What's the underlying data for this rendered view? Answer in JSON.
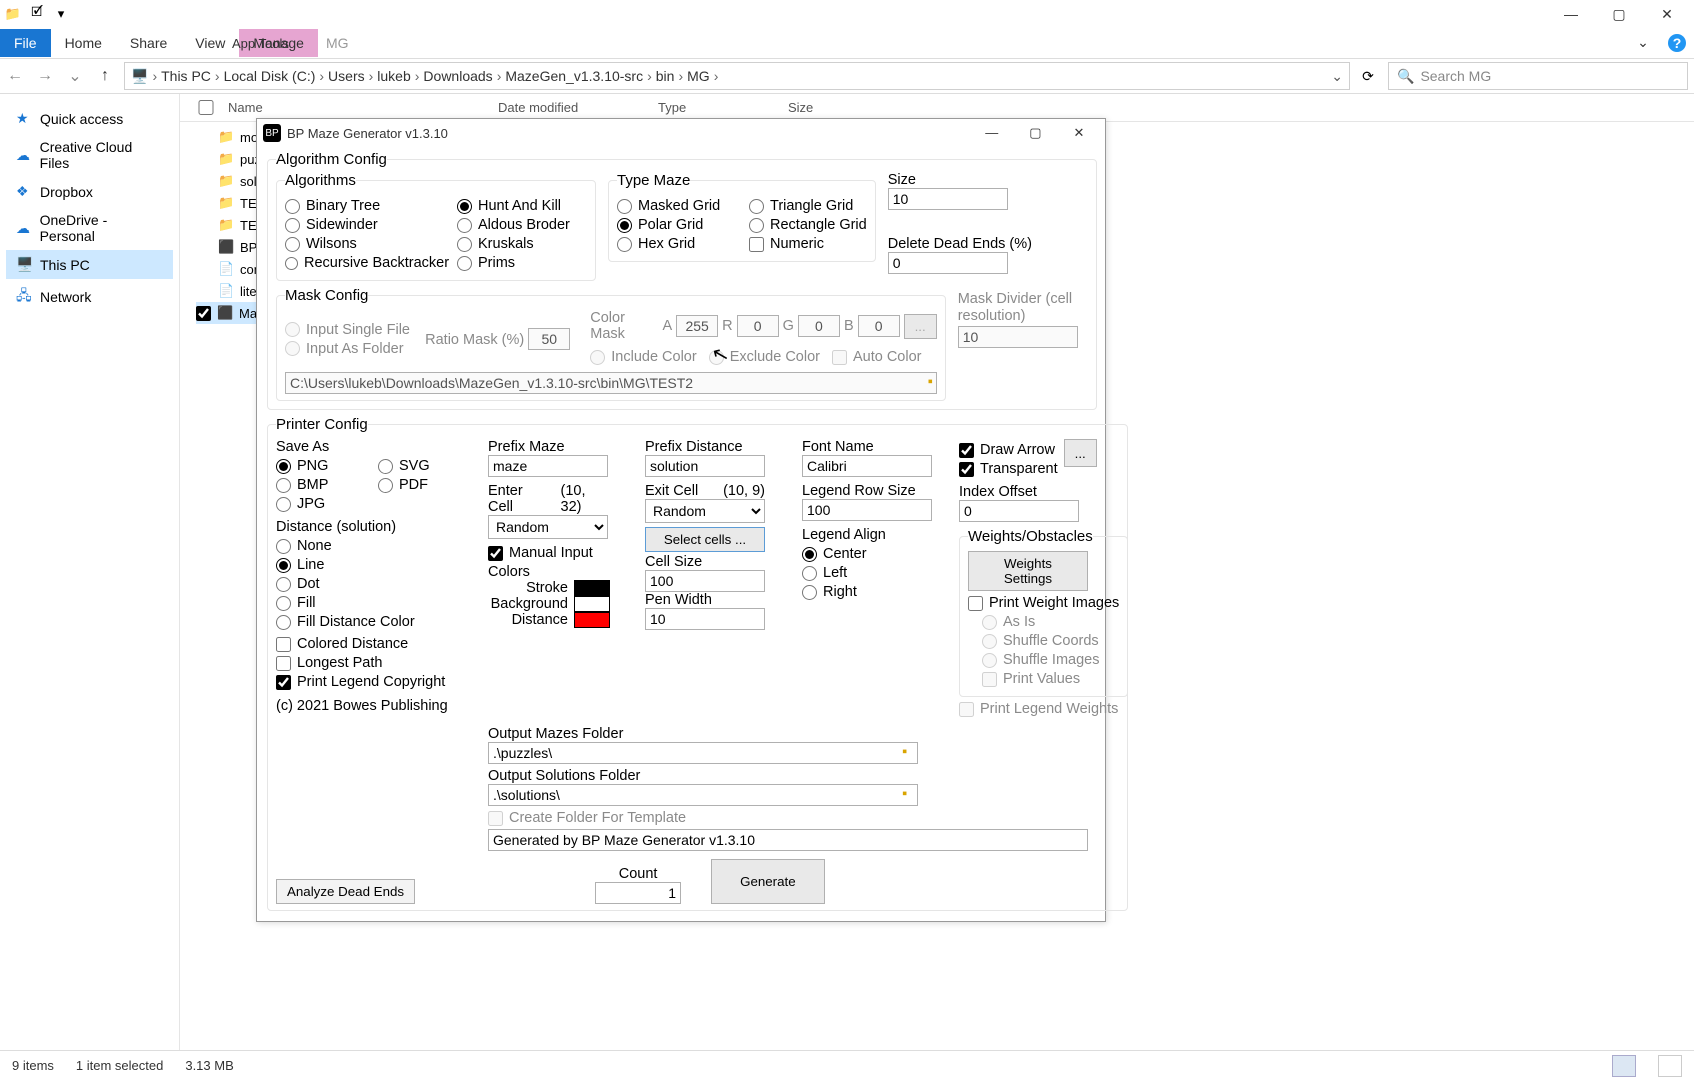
{
  "explorer": {
    "ribbon": {
      "file": "File",
      "home": "Home",
      "share": "Share",
      "view": "View",
      "manage": "Manage",
      "apptools": "App Tools",
      "folder_label": "MG"
    },
    "breadcrumb": [
      "This PC",
      "Local Disk (C:)",
      "Users",
      "lukeb",
      "Downloads",
      "MazeGen_v1.3.10-src",
      "bin",
      "MG"
    ],
    "search_placeholder": "Search MG",
    "sidebar": {
      "quick_access": "Quick access",
      "creative_cloud": "Creative Cloud Files",
      "dropbox": "Dropbox",
      "onedrive": "OneDrive - Personal",
      "this_pc": "This PC",
      "network": "Network"
    },
    "columns": {
      "name": "Name",
      "date": "Date modified",
      "type": "Type",
      "size": "Size"
    },
    "files": [
      "mor",
      "puz",
      "sol",
      "TES",
      "TES",
      "BP I",
      "con",
      "liteP",
      "Maz"
    ],
    "status": {
      "items": "9 items",
      "selected": "1 item selected",
      "size": "3.13 MB"
    }
  },
  "dialog": {
    "title": "BP Maze Generator v1.3.10",
    "algo_config": "Algorithm Config",
    "algorithms": {
      "title": "Algorithms",
      "binary_tree": "Binary Tree",
      "sidewinder": "Sidewinder",
      "wilsons": "Wilsons",
      "recursive": "Recursive Backtracker",
      "hunt_kill": "Hunt And Kill",
      "aldous": "Aldous Broder",
      "kruskals": "Kruskals",
      "prims": "Prims"
    },
    "type_maze": {
      "title": "Type Maze",
      "masked": "Masked Grid",
      "polar": "Polar Grid",
      "hex": "Hex Grid",
      "triangle": "Triangle Grid",
      "rectangle": "Rectangle Grid",
      "numeric": "Numeric"
    },
    "size": {
      "label": "Size",
      "value": "10"
    },
    "delete_dead": {
      "label": "Delete Dead Ends (%)",
      "value": "0"
    },
    "mask": {
      "title": "Mask Config",
      "single": "Input Single File",
      "folder": "Input As Folder",
      "ratio_label": "Ratio Mask (%)",
      "ratio_value": "50",
      "color_mask": "Color Mask",
      "a": "A",
      "a_val": "255",
      "r": "R",
      "r_val": "0",
      "g": "G",
      "g_val": "0",
      "b": "B",
      "b_val": "0",
      "browse": "...",
      "include": "Include Color",
      "exclude": "Exclude Color",
      "auto": "Auto Color",
      "path": "C:\\Users\\lukeb\\Downloads\\MazeGen_v1.3.10-src\\bin\\MG\\TEST2",
      "divider_label": "Mask Divider (cell resolution)",
      "divider_value": "10"
    },
    "printer": {
      "title": "Printer Config",
      "save_as": "Save As",
      "png": "PNG",
      "svg": "SVG",
      "bmp": "BMP",
      "pdf": "PDF",
      "jpg": "JPG",
      "distance_sol": "Distance (solution)",
      "none": "None",
      "line": "Line",
      "dot": "Dot",
      "fill": "Fill",
      "fill_dc": "Fill Distance Color",
      "colored_dist": "Colored Distance",
      "longest_path": "Longest Path",
      "print_legend_cr": "Print Legend Copyright",
      "copyright": "(c) 2021 Bowes Publishing"
    },
    "mid": {
      "prefix_maze": "Prefix Maze",
      "prefix_maze_val": "maze",
      "prefix_dist": "Prefix Distance",
      "prefix_dist_val": "solution",
      "enter_cell": "Enter Cell",
      "enter_cell_coord": "(10, 32)",
      "enter_cell_sel": "Random",
      "exit_cell": "Exit Cell",
      "exit_cell_coord": "(10, 9)",
      "exit_cell_sel": "Random",
      "manual_input": "Manual Input",
      "select_cells": "Select cells ...",
      "colors": "Colors",
      "stroke": "Stroke",
      "background": "Background",
      "distance": "Distance",
      "cell_size": "Cell Size",
      "cell_size_val": "100",
      "pen_width": "Pen Width",
      "pen_width_val": "10",
      "out_mazes": "Output Mazes Folder",
      "out_mazes_val": ".\\puzzles\\",
      "out_sol": "Output Solutions Folder",
      "out_sol_val": ".\\solutions\\",
      "create_folder": "Create Folder For Template",
      "gen_text": "Generated by BP Maze Generator v1.3.10"
    },
    "right": {
      "font_name": "Font Name",
      "font_name_val": "Calibri",
      "legend_row": "Legend Row Size",
      "legend_row_val": "100",
      "legend_align": "Legend Align",
      "center": "Center",
      "left": "Left",
      "right_": "Right",
      "draw_arrow": "Draw Arrow",
      "transparent": "Transparent",
      "dots": "...",
      "index_offset": "Index Offset",
      "index_offset_val": "0",
      "weights": "Weights/Obstacles",
      "weights_settings": "Weights Settings",
      "print_weight_images": "Print Weight Images",
      "as_is": "As Is",
      "shuffle_coords": "Shuffle Coords",
      "shuffle_images": "Shuffle Images",
      "print_values": "Print Values",
      "print_legend_weights": "Print Legend Weights"
    },
    "bottom": {
      "analyze": "Analyze Dead Ends",
      "count": "Count",
      "count_val": "1",
      "generate": "Generate"
    }
  }
}
